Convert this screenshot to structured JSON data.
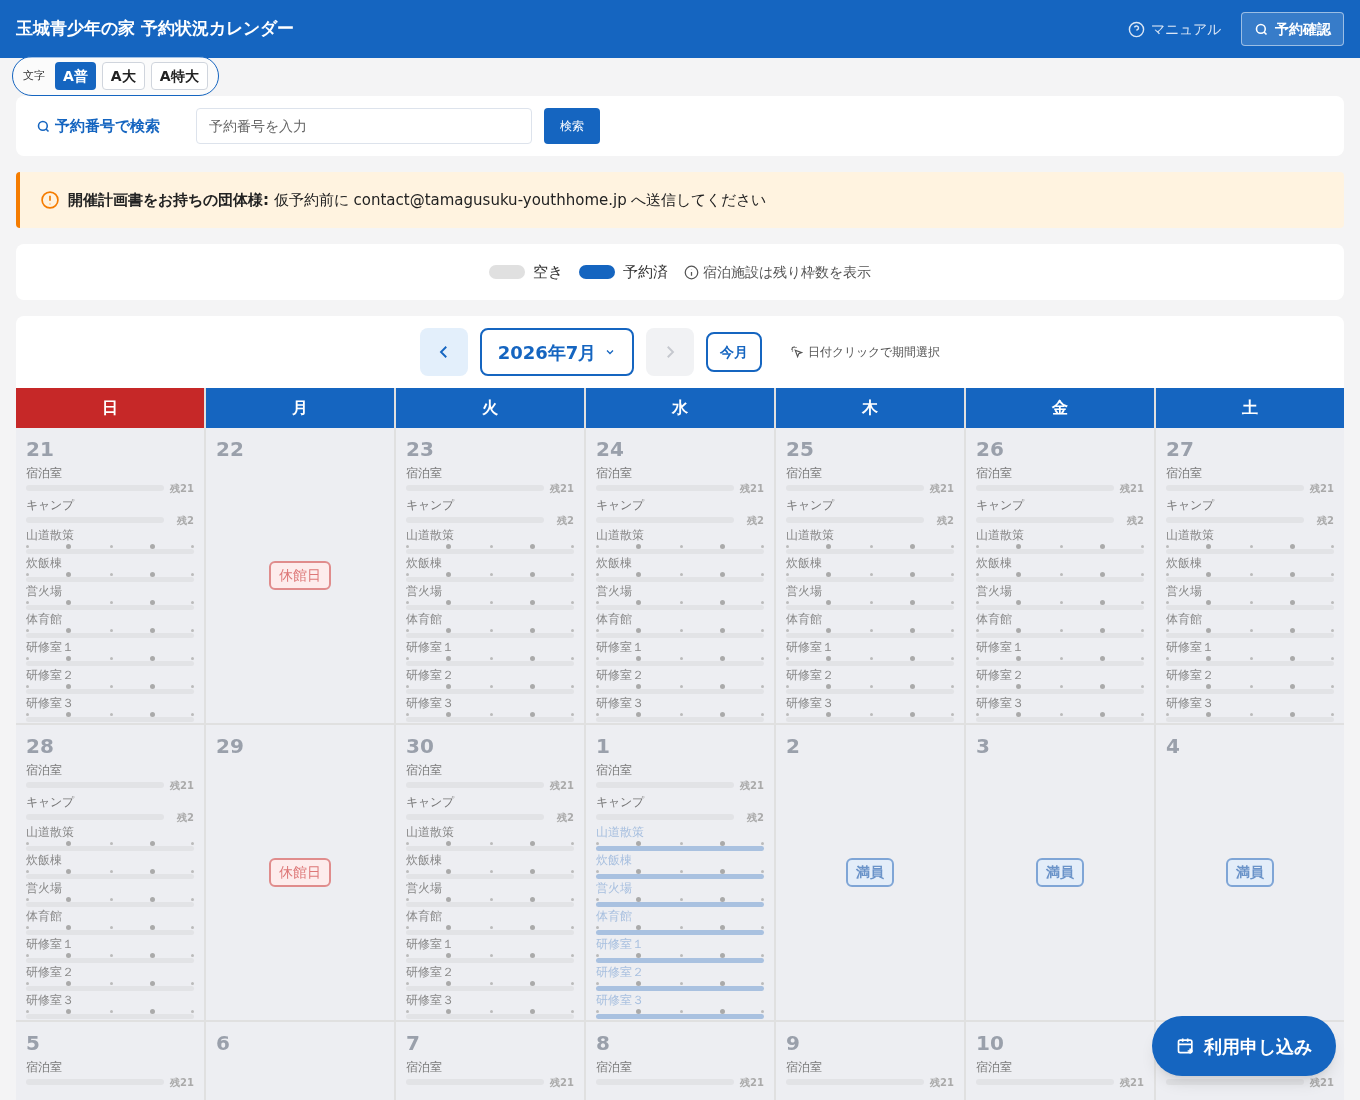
{
  "header": {
    "title": "玉城青少年の家 予約状況カレンダー",
    "manual_link": "マニュアル",
    "confirm_button": "予約確認"
  },
  "text_size": {
    "label": "文字",
    "options": [
      {
        "label": "A普",
        "selected": true
      },
      {
        "label": "A大",
        "selected": false
      },
      {
        "label": "A特大",
        "selected": false
      }
    ]
  },
  "search": {
    "title": "予約番号で検索",
    "placeholder": "予約番号を入力",
    "button": "検索"
  },
  "notice": {
    "text": "**開催計画書をお持ちの団体様:** 仮予約前に contact@tamagusuku-youthhome.jp へ送信してください"
  },
  "legend": {
    "items": [
      {
        "label": "空き",
        "color": "#e0e0e0"
      },
      {
        "label": "予約済",
        "color": "#1565c0"
      }
    ],
    "note": "宿泊施設は残り枠数を表示"
  },
  "calendar": {
    "month": "2026年7月",
    "today_button": "今月",
    "hint": "日付クリックで期間選択",
    "prev_disabled": false,
    "next_disabled": true,
    "weekdays": [
      {
        "label": "日",
        "color": "#c62828"
      },
      {
        "label": "月",
        "color": "#1565c0"
      },
      {
        "label": "火",
        "color": "#1565c0"
      },
      {
        "label": "水",
        "color": "#1565c0"
      },
      {
        "label": "木",
        "color": "#1565c0"
      },
      {
        "label": "金",
        "color": "#1565c0"
      },
      {
        "label": "土",
        "color": "#1565c0"
      }
    ],
    "weeks": [
      [
        {
          "day": "21",
          "kind": "open",
          "lodging": [
            {
              "name": "宿泊室",
              "remaining": "残21",
              "level": 0
            },
            {
              "name": "キャンプ",
              "remaining": "残2",
              "level": 0
            }
          ],
          "slots": [
            {
              "name": "山道散策",
              "booked": false
            },
            {
              "name": "炊飯棟",
              "booked": false
            },
            {
              "name": "営火場",
              "booked": false
            },
            {
              "name": "体育館",
              "booked": false
            },
            {
              "name": "研修室１",
              "booked": false
            },
            {
              "name": "研修室２",
              "booked": false
            },
            {
              "name": "研修室３",
              "booked": false
            }
          ]
        },
        {
          "day": "22",
          "kind": "closed",
          "badge": "休館日"
        },
        {
          "day": "23",
          "kind": "open",
          "lodging": [
            {
              "name": "宿泊室",
              "remaining": "残21",
              "level": 0
            },
            {
              "name": "キャンプ",
              "remaining": "残2",
              "level": 0
            }
          ],
          "slots": [
            {
              "name": "山道散策",
              "booked": false
            },
            {
              "name": "炊飯棟",
              "booked": false
            },
            {
              "name": "営火場",
              "booked": false
            },
            {
              "name": "体育館",
              "booked": false
            },
            {
              "name": "研修室１",
              "booked": false
            },
            {
              "name": "研修室２",
              "booked": false
            },
            {
              "name": "研修室３",
              "booked": false
            }
          ]
        },
        {
          "day": "24",
          "kind": "open",
          "lodging": [
            {
              "name": "宿泊室",
              "remaining": "残21",
              "level": 0
            },
            {
              "name": "キャンプ",
              "remaining": "残2",
              "level": 0
            }
          ],
          "slots": [
            {
              "name": "山道散策",
              "booked": false
            },
            {
              "name": "炊飯棟",
              "booked": false
            },
            {
              "name": "営火場",
              "booked": false
            },
            {
              "name": "体育館",
              "booked": false
            },
            {
              "name": "研修室１",
              "booked": false
            },
            {
              "name": "研修室２",
              "booked": false
            },
            {
              "name": "研修室３",
              "booked": false
            }
          ]
        },
        {
          "day": "25",
          "kind": "open",
          "lodging": [
            {
              "name": "宿泊室",
              "remaining": "残21",
              "level": 0
            },
            {
              "name": "キャンプ",
              "remaining": "残2",
              "level": 0
            }
          ],
          "slots": [
            {
              "name": "山道散策",
              "booked": false
            },
            {
              "name": "炊飯棟",
              "booked": false
            },
            {
              "name": "営火場",
              "booked": false
            },
            {
              "name": "体育館",
              "booked": false
            },
            {
              "name": "研修室１",
              "booked": false
            },
            {
              "name": "研修室２",
              "booked": false
            },
            {
              "name": "研修室３",
              "booked": false
            }
          ]
        },
        {
          "day": "26",
          "kind": "open",
          "lodging": [
            {
              "name": "宿泊室",
              "remaining": "残21",
              "level": 0
            },
            {
              "name": "キャンプ",
              "remaining": "残2",
              "level": 0
            }
          ],
          "slots": [
            {
              "name": "山道散策",
              "booked": false
            },
            {
              "name": "炊飯棟",
              "booked": false
            },
            {
              "name": "営火場",
              "booked": false
            },
            {
              "name": "体育館",
              "booked": false
            },
            {
              "name": "研修室１",
              "booked": false
            },
            {
              "name": "研修室２",
              "booked": false
            },
            {
              "name": "研修室３",
              "booked": false
            }
          ]
        },
        {
          "day": "27",
          "kind": "open",
          "lodging": [
            {
              "name": "宿泊室",
              "remaining": "残21",
              "level": 0
            },
            {
              "name": "キャンプ",
              "remaining": "残2",
              "level": 0
            }
          ],
          "slots": [
            {
              "name": "山道散策",
              "booked": false
            },
            {
              "name": "炊飯棟",
              "booked": false
            },
            {
              "name": "営火場",
              "booked": false
            },
            {
              "name": "体育館",
              "booked": false
            },
            {
              "name": "研修室１",
              "booked": false
            },
            {
              "name": "研修室２",
              "booked": false
            },
            {
              "name": "研修室３",
              "booked": false
            }
          ]
        }
      ],
      [
        {
          "day": "28",
          "kind": "open",
          "lodging": [
            {
              "name": "宿泊室",
              "remaining": "残21",
              "level": 0
            },
            {
              "name": "キャンプ",
              "remaining": "残2",
              "level": 0
            }
          ],
          "slots": [
            {
              "name": "山道散策",
              "booked": false
            },
            {
              "name": "炊飯棟",
              "booked": false
            },
            {
              "name": "営火場",
              "booked": false
            },
            {
              "name": "体育館",
              "booked": false
            },
            {
              "name": "研修室１",
              "booked": false
            },
            {
              "name": "研修室２",
              "booked": false
            },
            {
              "name": "研修室３",
              "booked": false
            }
          ]
        },
        {
          "day": "29",
          "kind": "closed",
          "badge": "休館日"
        },
        {
          "day": "30",
          "kind": "open",
          "lodging": [
            {
              "name": "宿泊室",
              "remaining": "残21",
              "level": 0
            },
            {
              "name": "キャンプ",
              "remaining": "残2",
              "level": 0
            }
          ],
          "slots": [
            {
              "name": "山道散策",
              "booked": false
            },
            {
              "name": "炊飯棟",
              "booked": false
            },
            {
              "name": "営火場",
              "booked": false
            },
            {
              "name": "体育館",
              "booked": false
            },
            {
              "name": "研修室１",
              "booked": false
            },
            {
              "name": "研修室２",
              "booked": false
            },
            {
              "name": "研修室３",
              "booked": false
            }
          ]
        },
        {
          "day": "1",
          "kind": "open",
          "lodging": [
            {
              "name": "宿泊室",
              "remaining": "残21",
              "level": 0
            },
            {
              "name": "キャンプ",
              "remaining": "残2",
              "level": 0
            }
          ],
          "slots": [
            {
              "name": "山道散策",
              "booked": true
            },
            {
              "name": "炊飯棟",
              "booked": true
            },
            {
              "name": "営火場",
              "booked": true
            },
            {
              "name": "体育館",
              "booked": true
            },
            {
              "name": "研修室１",
              "booked": true
            },
            {
              "name": "研修室２",
              "booked": true
            },
            {
              "name": "研修室３",
              "booked": true
            }
          ]
        },
        {
          "day": "2",
          "kind": "full",
          "badge": "満員"
        },
        {
          "day": "3",
          "kind": "full",
          "badge": "満員"
        },
        {
          "day": "4",
          "kind": "full",
          "badge": "満員"
        }
      ],
      [
        {
          "day": "5",
          "kind": "open",
          "lodging": [
            {
              "name": "宿泊室",
              "remaining": "残21",
              "level": 0
            }
          ]
        },
        {
          "day": "6",
          "kind": "closed"
        },
        {
          "day": "7",
          "kind": "open",
          "lodging": [
            {
              "name": "宿泊室",
              "remaining": "残21",
              "level": 0
            }
          ]
        },
        {
          "day": "8",
          "kind": "open",
          "lodging": [
            {
              "name": "宿泊室",
              "remaining": "残21",
              "level": 0
            }
          ]
        },
        {
          "day": "9",
          "kind": "open",
          "lodging": [
            {
              "name": "宿泊室",
              "remaining": "残21",
              "level": 0
            }
          ]
        },
        {
          "day": "10",
          "kind": "open",
          "lodging": [
            {
              "name": "宿泊室",
              "remaining": "残21",
              "level": 0
            }
          ]
        },
        {
          "kind": "open",
          "lodging": [
            {
              "remaining": "残21",
              "level": 0
            }
          ]
        }
      ]
    ]
  },
  "apply_button": "利用申し込み"
}
